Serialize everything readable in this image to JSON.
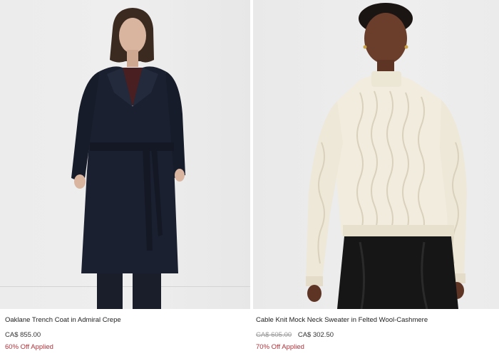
{
  "theme": {
    "promo_color": "#b1343b"
  },
  "products": [
    {
      "name": "Oaklane Trench Coat in Admiral Crepe",
      "price": "CA$ 855.00",
      "original_price": "",
      "promo": "60% Off Applied"
    },
    {
      "name": "Cable Knit Mock Neck Sweater in Felted Wool-Cashmere",
      "price": "CA$ 302.50",
      "original_price": "CA$ 605.00",
      "promo": "70% Off Applied"
    }
  ]
}
